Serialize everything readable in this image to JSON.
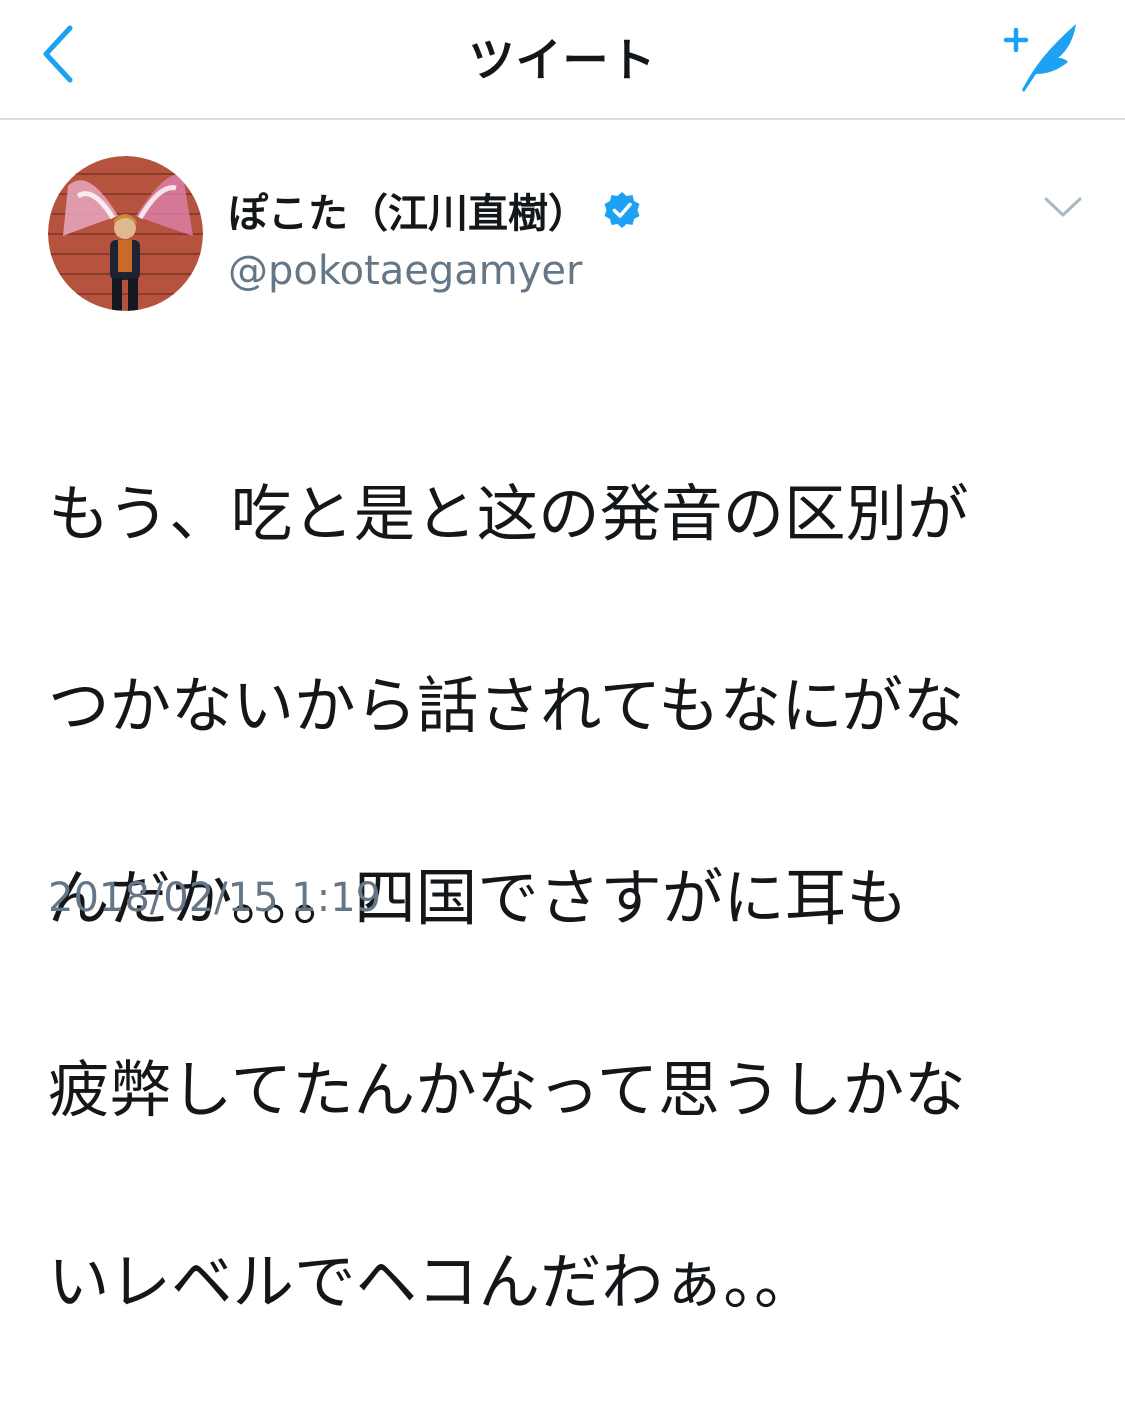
{
  "header": {
    "title": "ツイート",
    "back_icon": "chevron-left-icon",
    "compose_icon": "compose-tweet-icon",
    "accent_color": "#1da1f2"
  },
  "tweet": {
    "display_name": "ぽこた（江川直樹）",
    "handle": "@pokotaegamyer",
    "verified": true,
    "text_lines": [
      "もう、吃と是と这の発音の区別が",
      "つかないから話されてもなにがな",
      "んだか。。。四国でさすがに耳も",
      "疲弊してたんかなって思うしかな",
      "いレベルでヘコんだわぁ。。"
    ],
    "timestamp": "2018/02/15 1:19"
  },
  "colors": {
    "text_primary": "#14171a",
    "text_secondary": "#657786",
    "divider": "#d8dde1"
  }
}
